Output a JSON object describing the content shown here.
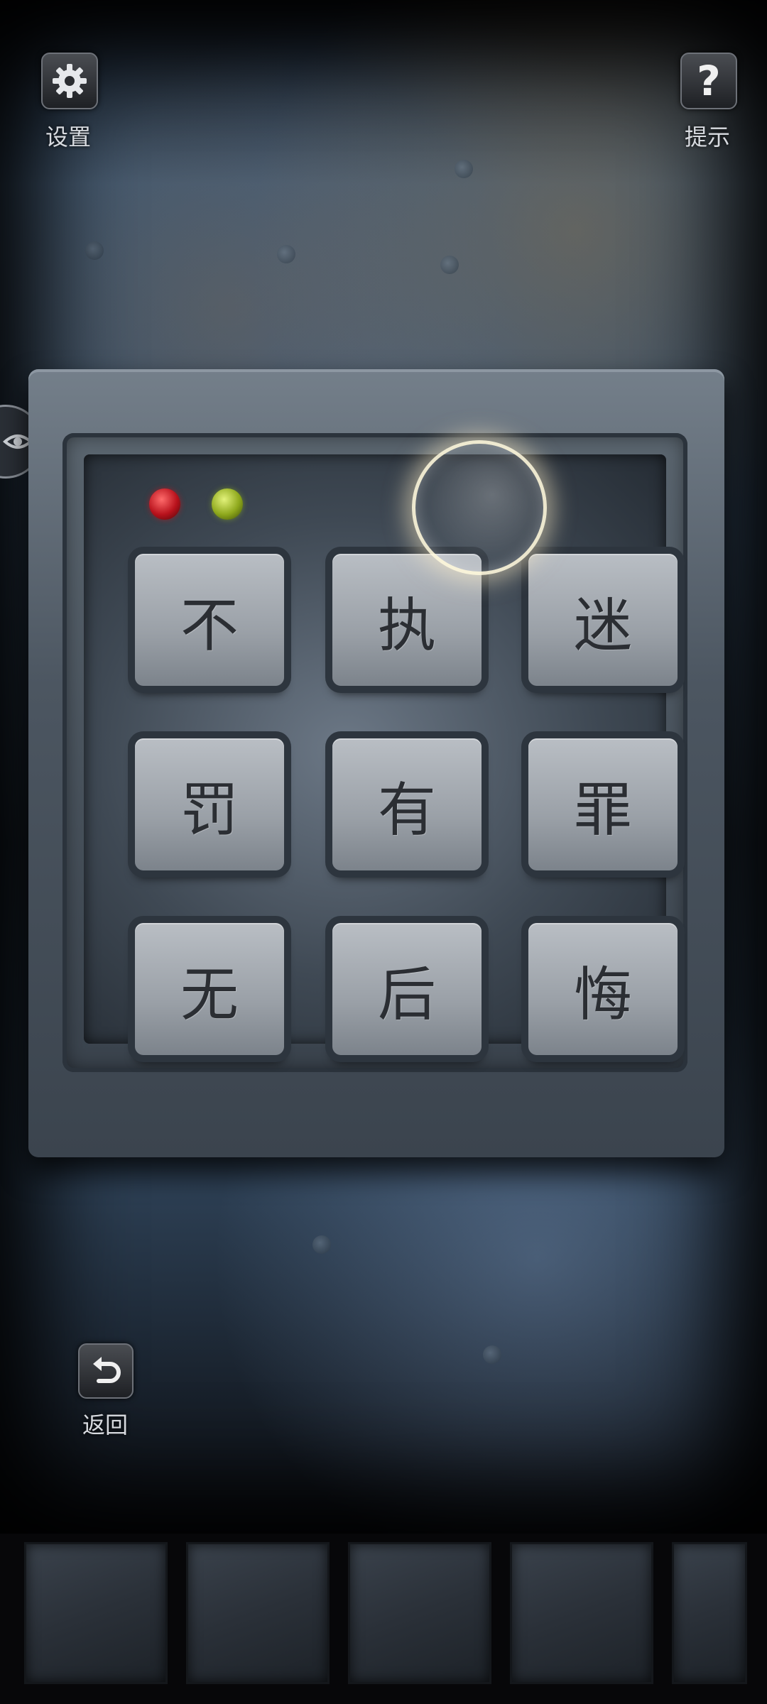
{
  "top_bar": {
    "settings": {
      "label": "设置",
      "icon": "gear-icon"
    },
    "hint": {
      "label": "提示",
      "icon": "question-mark-icon"
    }
  },
  "keypad": {
    "indicator_lights": [
      {
        "color": "#c81e28",
        "state": "red"
      },
      {
        "color": "#a6c02a",
        "state": "green"
      }
    ],
    "keys": [
      {
        "char": "不"
      },
      {
        "char": "执"
      },
      {
        "char": "迷"
      },
      {
        "char": "罚"
      },
      {
        "char": "有"
      },
      {
        "char": "罪"
      },
      {
        "char": "无"
      },
      {
        "char": "后"
      },
      {
        "char": "悔"
      }
    ]
  },
  "side_tab": {
    "icon": "eye-icon"
  },
  "back": {
    "label": "返回",
    "icon": "undo-arrow-icon"
  },
  "inventory": {
    "slot_count": 5
  },
  "colors": {
    "key_face": "#9aa0a7",
    "key_text": "#2b2e33",
    "label_text": "#d8dbe0"
  }
}
